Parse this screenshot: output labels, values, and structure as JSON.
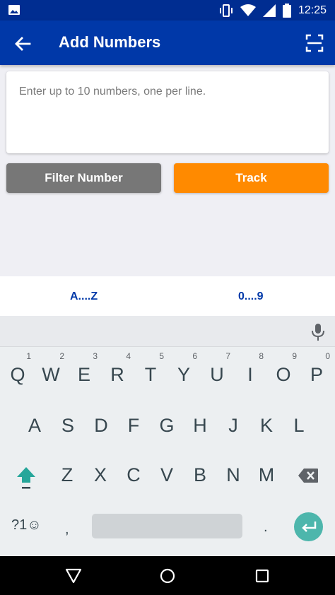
{
  "status_bar": {
    "time": "12:25"
  },
  "app_bar": {
    "title": "Add Numbers"
  },
  "input": {
    "placeholder": "Enter up to 10 numbers, one per line."
  },
  "buttons": {
    "filter_label": "Filter Number",
    "track_label": "Track"
  },
  "keyboard_modes": {
    "letters": "A....Z",
    "digits": "0....9"
  },
  "keyboard": {
    "row1": [
      {
        "key": "Q",
        "hint": "1"
      },
      {
        "key": "W",
        "hint": "2"
      },
      {
        "key": "E",
        "hint": "3"
      },
      {
        "key": "R",
        "hint": "4"
      },
      {
        "key": "T",
        "hint": "5"
      },
      {
        "key": "Y",
        "hint": "6"
      },
      {
        "key": "U",
        "hint": "7"
      },
      {
        "key": "I",
        "hint": "8"
      },
      {
        "key": "O",
        "hint": "9"
      },
      {
        "key": "P",
        "hint": "0"
      }
    ],
    "row2": [
      "A",
      "S",
      "D",
      "F",
      "G",
      "H",
      "J",
      "K",
      "L"
    ],
    "row3": [
      "Z",
      "X",
      "C",
      "V",
      "B",
      "N",
      "M"
    ],
    "symbols_key": "?1☺",
    "comma_key": ",",
    "period_key": "."
  },
  "colors": {
    "app_bar": "#0038a8",
    "status_bar": "#002d91",
    "track_button": "#ff8a00",
    "filter_button": "#777777",
    "mode_text": "#0038a8",
    "enter_key": "#4db6ac"
  },
  "icons": {
    "status_left": "image-icon",
    "status_right": [
      "vibrate-icon",
      "wifi-icon",
      "cell-signal-icon",
      "battery-icon"
    ],
    "back": "arrow-back-icon",
    "scan": "scan-icon",
    "mic": "mic-icon",
    "shift": "shift-icon",
    "backspace": "backspace-icon",
    "enter": "enter-icon",
    "nav": [
      "nav-back-icon",
      "nav-home-icon",
      "nav-recents-icon"
    ]
  }
}
